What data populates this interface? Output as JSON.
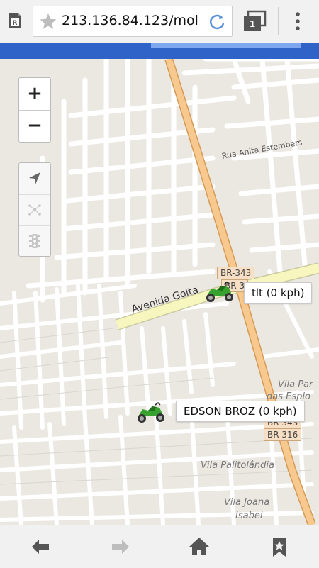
{
  "browser": {
    "url": "213.136.84.123/mol",
    "tab_count": "1",
    "accent_color": "#2f63c8",
    "load_progress_fraction": 0.47
  },
  "map": {
    "street_labels": {
      "avenida": "Avenida Golta",
      "rua": "Rua Anita Estembers",
      "br343_top": "BR-343",
      "br3_top": "BR-3",
      "vila_par": "Vila Par",
      "das_esplo": "das Esplo",
      "br343_bottom": "BR-343",
      "br316": "BR-316",
      "vila_palitolandia": "Vila Palitolândia",
      "vila_joana": "Vila Joana",
      "isabel": "Isabel"
    },
    "controls": {
      "zoom_in": "+",
      "zoom_out": "−"
    },
    "vehicles": [
      {
        "label": "tlt (0 kph)"
      },
      {
        "label": "EDSON BROZ (0 kph)"
      }
    ]
  }
}
